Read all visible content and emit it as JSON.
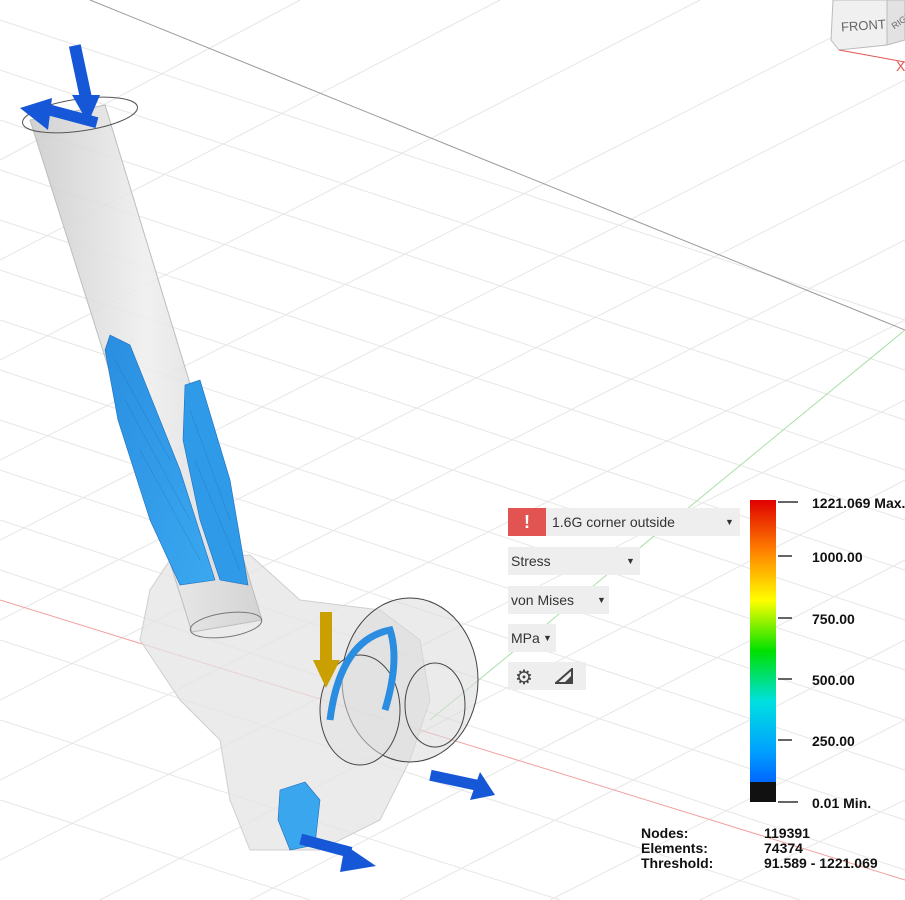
{
  "viewcube": {
    "front_label": "FRONT",
    "right_label": "RIGHT",
    "x_axis_label": "X"
  },
  "result_panel": {
    "warning_icon": "exclamation-warning-icon",
    "load_case": "1.6G corner outside",
    "result_type": "Stress",
    "component": "von Mises",
    "unit": "MPa",
    "settings_icon": "gear-icon",
    "probe_icon": "triangle-ruler-icon",
    "dropdown_icon": "caret-down-icon"
  },
  "legend": {
    "max_label": "1221.069 Max.",
    "ticks": [
      "1000.00",
      "750.00",
      "500.00",
      "250.00"
    ],
    "min_label": "0.01 Min.",
    "colors": [
      "#e00000",
      "#ff8000",
      "#ffff00",
      "#00e000",
      "#00e0e0",
      "#00a0ff",
      "#0040ff",
      "#111111"
    ]
  },
  "stats": {
    "nodes_label": "Nodes:",
    "nodes_value": "119391",
    "elements_label": "Elements:",
    "elements_value": "74374",
    "threshold_label": "Threshold:",
    "threshold_value": "91.589 - 1221.069"
  }
}
